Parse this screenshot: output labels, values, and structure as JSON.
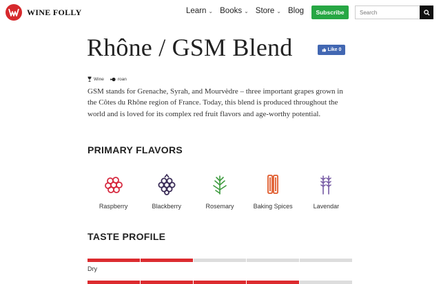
{
  "header": {
    "logo_text": "WINE FOLLY",
    "nav": [
      {
        "label": "Learn",
        "dropdown": true
      },
      {
        "label": "Books",
        "dropdown": true
      },
      {
        "label": "Store",
        "dropdown": true
      },
      {
        "label": "Blog",
        "dropdown": false
      }
    ],
    "subscribe_label": "Subscribe",
    "search_placeholder": "Search"
  },
  "page": {
    "title": "Rhône / GSM Blend",
    "like_label": "Like 0",
    "meta": [
      {
        "icon": "wine-glass-icon",
        "label": "Wine"
      },
      {
        "icon": "grape-color-icon",
        "label": "roan"
      }
    ],
    "description": "GSM stands for Grenache, Syrah, and Mourvèdre – three important grapes grown in the Côtes du Rhône region of France. Today, this blend is produced throughout the world and is loved for its complex red fruit flavors and age-worthy potential."
  },
  "primary_flavors": {
    "heading": "PRIMARY FLAVORS",
    "items": [
      {
        "label": "Raspberry",
        "icon": "raspberry-icon",
        "color": "#d6293f"
      },
      {
        "label": "Blackberry",
        "icon": "blackberry-icon",
        "color": "#3a2c57"
      },
      {
        "label": "Rosemary",
        "icon": "rosemary-icon",
        "color": "#3c9a3d"
      },
      {
        "label": "Baking Spices",
        "icon": "cinnamon-stick-icon",
        "color": "#e05a2a"
      },
      {
        "label": "Lavendar",
        "icon": "lavender-icon",
        "color": "#7559a3"
      }
    ]
  },
  "taste_profile": {
    "heading": "TASTE PROFILE",
    "rows": [
      {
        "label": "Dry",
        "level": 2,
        "max": 5
      },
      {
        "label": "",
        "level": 4,
        "max": 5
      }
    ]
  },
  "colors": {
    "brand_red": "#d6292c",
    "subscribe_green": "#27a744",
    "like_blue": "#4267b2",
    "bar_active": "#dc2b2f",
    "bar_inactive": "#dddddd"
  }
}
